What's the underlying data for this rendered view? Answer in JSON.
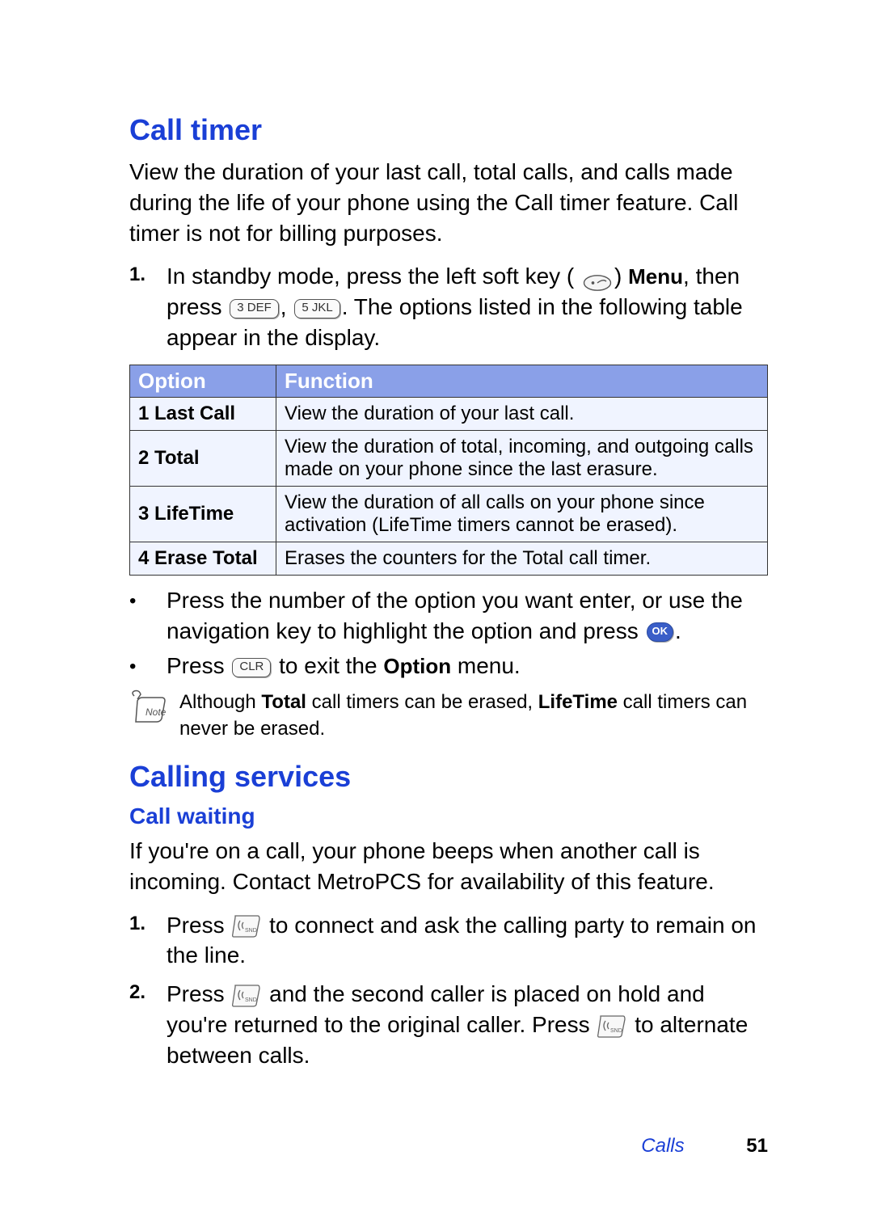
{
  "headings": {
    "call_timer": "Call timer",
    "calling_services": "Calling services",
    "call_waiting": "Call waiting"
  },
  "call_timer": {
    "intro": "View the duration of your last call, total calls, and calls made during the life of your phone using the Call timer feature. Call timer is not for billing purposes.",
    "step1": {
      "num": "1.",
      "pre": "In standby mode, press the left soft key (",
      "menu_label": "Menu",
      "mid1": ", then press ",
      "key3": "3 DEF",
      "comma": ", ",
      "key5": "5 JKL",
      "post": ". The options listed in the following table appear in the display."
    },
    "table": {
      "head_option": "Option",
      "head_function": "Function",
      "rows": [
        {
          "opt": "1 Last Call",
          "func": "View the duration of your last call."
        },
        {
          "opt": "2 Total",
          "func": "View the duration of total, incoming, and outgoing calls made on your phone since the last erasure."
        },
        {
          "opt": "3 LifeTime",
          "func": "View the duration of all calls on your phone since activation (LifeTime timers cannot be erased)."
        },
        {
          "opt": "4 Erase Total",
          "func": "Erases the counters for the Total call timer."
        }
      ]
    },
    "bullet1": {
      "pre": "Press the number of the option you want enter, or use the navigation key to highlight the option and press ",
      "ok_label": "OK",
      "post": "."
    },
    "bullet2": {
      "pre": "Press ",
      "clr_label": "CLR",
      "mid": " to exit the ",
      "option_label": "Option",
      "post": " menu."
    },
    "note": {
      "pre": "Although ",
      "total": "Total",
      "mid": " call timers can be erased, ",
      "lifetime": "LifeTime",
      "post": " call timers can never be erased."
    }
  },
  "call_waiting": {
    "intro": "If you're on a call, your phone beeps when another call is incoming. Contact MetroPCS for availability of this feature.",
    "step1": {
      "num": "1.",
      "pre": "Press ",
      "post": " to connect and ask the calling party to remain on the line."
    },
    "step2": {
      "num": "2.",
      "pre": "Press ",
      "mid": " and the second caller is placed on hold and you're returned to the original caller. Press ",
      "post": " to alternate between calls."
    }
  },
  "footer": {
    "section": "Calls",
    "page": "51"
  },
  "icons": {
    "softkey": "left-softkey-icon",
    "note": "note-icon",
    "send": "send-key-icon"
  }
}
